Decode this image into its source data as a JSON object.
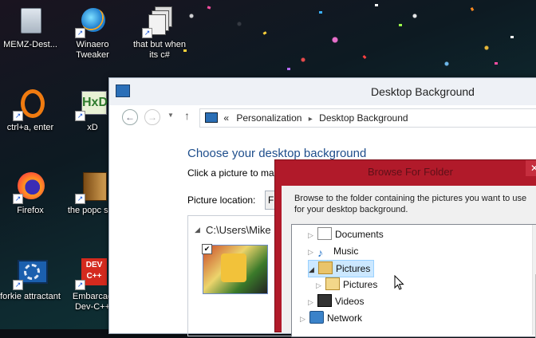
{
  "desktop": {
    "icons": [
      {
        "label": "MEMZ-Dest...",
        "icon": "recycle-bin-icon"
      },
      {
        "label": "Winaero Tweaker",
        "icon": "winaero-icon"
      },
      {
        "label": "that but when its c#",
        "icon": "stacked-windows-icon"
      },
      {
        "label": "ctrl+a, enter",
        "icon": "orange-ring-icon"
      },
      {
        "label": "xD",
        "icon": "hxd-icon"
      },
      {
        "label": "Firefox",
        "icon": "firefox-icon"
      },
      {
        "label": "the popc shit",
        "icon": "book-icon"
      },
      {
        "label": "forkie attractant",
        "icon": "gear-monitor-icon"
      },
      {
        "label": "Embarcad Dev-C++",
        "icon": "devcpp-icon"
      }
    ]
  },
  "window": {
    "title": "Desktop Background",
    "address": {
      "prefix": "«",
      "crumb1": "Personalization",
      "sep": "▸",
      "crumb2": "Desktop Background"
    },
    "heading": "Choose your desktop background",
    "subheading": "Click a picture to ma",
    "picture_location_label": "Picture location:",
    "picture_location_value": "Fi",
    "folder_path": "C:\\Users\\Mike"
  },
  "dialog": {
    "title": "Browse For Folder",
    "close_label": "✕",
    "description": "Browse to the folder containing the pictures you want to use for your desktop background.",
    "tree": [
      {
        "label": "Documents",
        "icon": "documents-icon",
        "expanded": false,
        "selected": false
      },
      {
        "label": "Music",
        "icon": "music-icon",
        "expanded": false,
        "selected": false
      },
      {
        "label": "Pictures",
        "icon": "folder-icon",
        "expanded": true,
        "selected": true
      },
      {
        "label": "Pictures",
        "icon": "folder-icon",
        "expanded": false,
        "selected": false
      },
      {
        "label": "Videos",
        "icon": "videos-icon",
        "expanded": false,
        "selected": false
      },
      {
        "label": "Network",
        "icon": "network-icon",
        "expanded": false,
        "selected": false
      }
    ]
  }
}
